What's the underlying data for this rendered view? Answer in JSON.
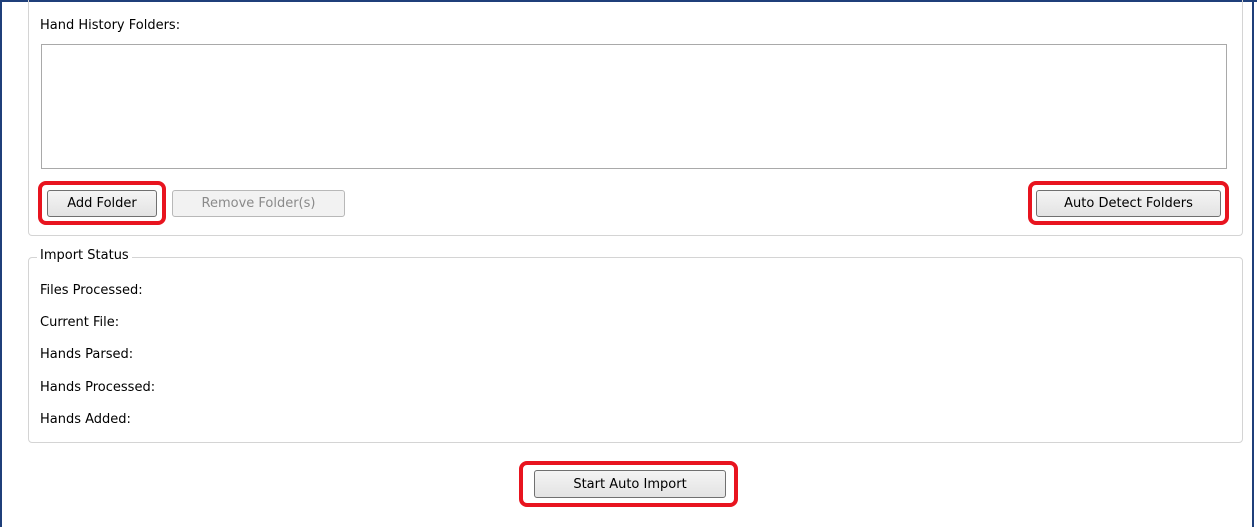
{
  "folders_section": {
    "label": "Hand History Folders:",
    "add_folder_label": "Add Folder",
    "remove_folder_label": "Remove Folder(s)",
    "auto_detect_label": "Auto Detect Folders"
  },
  "import_status": {
    "title": "Import Status",
    "rows": [
      {
        "label": "Files Processed:"
      },
      {
        "label": "Current File:"
      },
      {
        "label": "Hands Parsed:"
      },
      {
        "label": "Hands Processed:"
      },
      {
        "label": "Hands Added:"
      }
    ]
  },
  "actions": {
    "start_auto_import_label": "Start Auto Import"
  },
  "colors": {
    "highlight": "#e8141f",
    "frame": "#1f3f7a"
  }
}
